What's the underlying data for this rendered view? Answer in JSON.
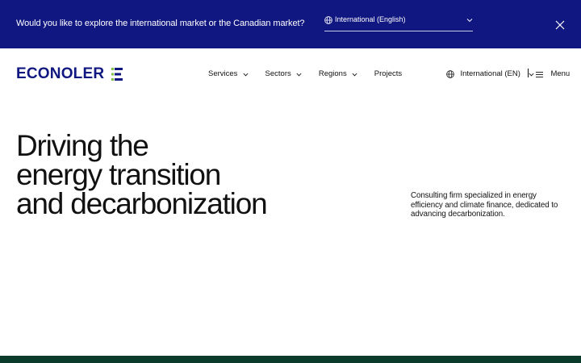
{
  "banner": {
    "question": "Would you like to explore the international market or the Canadian market?",
    "market_select": {
      "selected": "International (English)",
      "icon": "globe-icon",
      "chevron_icon": "chevron-down-icon"
    },
    "close_icon": "close-icon",
    "background_color": "#111780"
  },
  "header": {
    "logo": {
      "text": "ECONOLER",
      "mark_icon": "econoler-e-mark-icon",
      "color": "#111780",
      "accent_color": "#7cc242"
    },
    "nav": [
      {
        "label": "Services",
        "has_dropdown": true
      },
      {
        "label": "Sectors",
        "has_dropdown": true
      },
      {
        "label": "Regions",
        "has_dropdown": true
      },
      {
        "label": "Projects",
        "has_dropdown": false
      }
    ],
    "language": {
      "label": "International (EN)",
      "icon": "globe-icon",
      "chevron_icon": "chevron-down-icon"
    },
    "menu": {
      "label": "Menu",
      "icon": "hamburger-icon"
    }
  },
  "hero": {
    "title_lines": [
      "Driving the",
      "energy transition",
      "and decarbonization"
    ],
    "description": "Consulting firm specialized in energy efficiency and climate finance, dedicated to advancing decarbonization."
  },
  "footer_band": {
    "color": "#0b3b2b"
  }
}
